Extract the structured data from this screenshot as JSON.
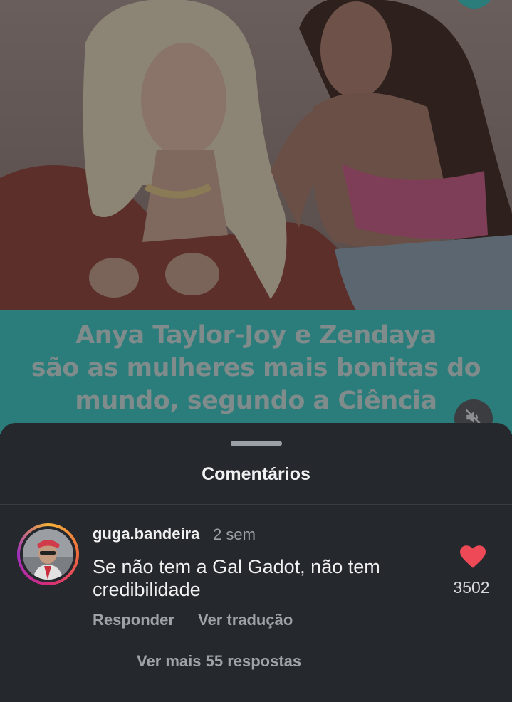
{
  "post": {
    "headline_lines": [
      "Anya Taylor-Joy e Zendaya",
      "são as mulheres mais bonitas do",
      "mundo, segundo a Ciência"
    ],
    "banner_color": "#2a7d7b",
    "mute_icon": "speaker-muted-icon"
  },
  "comments_sheet": {
    "title": "Comentários",
    "comment": {
      "username": "guga.bandeira",
      "time": "2 sem",
      "text": "Se não tem a Gal Gadot, não tem credibilidade",
      "likes": "3502",
      "liked": true,
      "like_color": "#ed4956",
      "reply_label": "Responder",
      "translate_label": "Ver tradução",
      "more_replies_label": "Ver mais 55 respostas"
    }
  },
  "colors": {
    "sheet_background": "#25282d",
    "text_primary": "#f1f1f1",
    "text_secondary": "#9ea3a8"
  }
}
